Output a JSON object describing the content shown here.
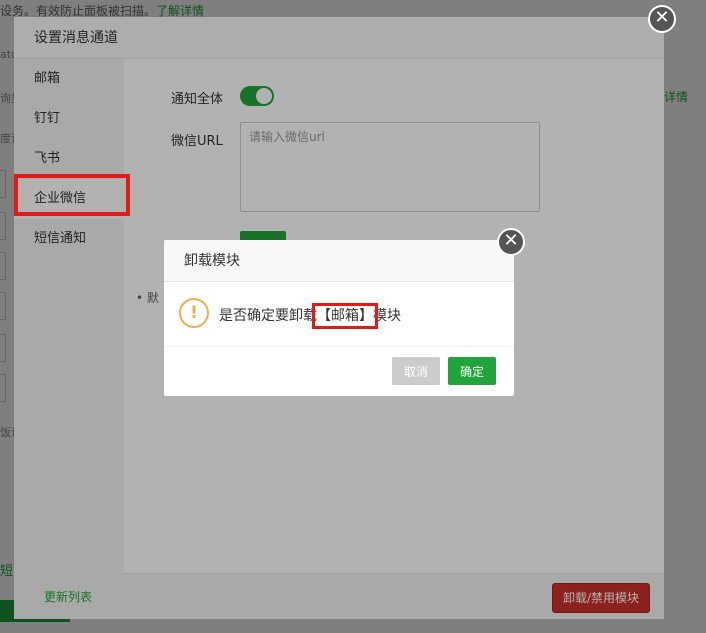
{
  "background": {
    "top_text": "设务。有效防止面板被扫描。",
    "top_link": "了解详情",
    "right_link": "详情",
    "left_fragments": [
      "ato",
      "询男",
      "度设",
      "饭访",
      "短"
    ]
  },
  "main_dialog": {
    "title": "设置消息通道",
    "sidebar": {
      "items": [
        {
          "label": "邮箱"
        },
        {
          "label": "钉钉"
        },
        {
          "label": "飞书"
        },
        {
          "label": "企业微信"
        },
        {
          "label": "短信通知"
        }
      ],
      "refresh_link": "更新列表"
    },
    "form": {
      "notify_all_label": "通知全体",
      "notify_all_on": true,
      "wechat_url_label": "微信URL",
      "wechat_url_placeholder": "请输入微信url",
      "wechat_url_value": ""
    },
    "bullet_fragment": "• 默",
    "uninstall_button": "卸载/禁用模块",
    "close_symbol": "✕"
  },
  "confirm_dialog": {
    "title": "卸载模块",
    "warning_symbol": "!",
    "message_prefix": "是否确定要卸载",
    "module_name": "【邮箱】",
    "message_suffix": "模块",
    "cancel_label": "取消",
    "ok_label": "确定",
    "close_symbol": "✕"
  },
  "colors": {
    "accent": "#20a53a",
    "danger": "#c9302c",
    "warning": "#f0ad4e",
    "highlight": "#e01b1b"
  }
}
